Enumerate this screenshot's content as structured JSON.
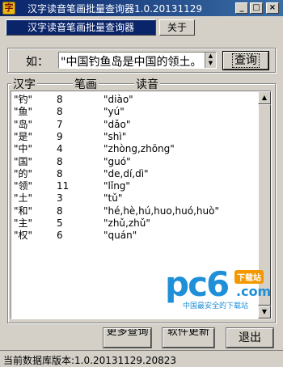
{
  "window": {
    "title": "汉字读音笔画批量查询器1.0.20131129",
    "minimize": "_",
    "maximize": "□",
    "close": "×"
  },
  "tabs": {
    "main": "汉字读音笔画批量查询器",
    "about": "关于"
  },
  "query": {
    "example_label": "如：",
    "input_value": "\"中国钓鱼岛是中国的领土。",
    "button": "查询"
  },
  "results": {
    "columns": {
      "char": "汉字",
      "stroke": "笔画",
      "pron": "读音"
    },
    "rows": [
      {
        "char": "\"钓\"",
        "stroke": "8",
        "pron": "\"diào\""
      },
      {
        "char": "\"鱼\"",
        "stroke": "8",
        "pron": "\"yú\""
      },
      {
        "char": "\"岛\"",
        "stroke": "7",
        "pron": "\"dǎo\""
      },
      {
        "char": "\"是\"",
        "stroke": "9",
        "pron": "\"shì\""
      },
      {
        "char": "\"中\"",
        "stroke": "4",
        "pron": "\"zhòng,zhōng\""
      },
      {
        "char": "\"国\"",
        "stroke": "8",
        "pron": "\"guó\""
      },
      {
        "char": "\"的\"",
        "stroke": "8",
        "pron": "\"de,dí,dì\""
      },
      {
        "char": "\"领\"",
        "stroke": "11",
        "pron": "\"lǐng\""
      },
      {
        "char": "\"土\"",
        "stroke": "3",
        "pron": "\"tǔ\""
      },
      {
        "char": "\"和\"",
        "stroke": "8",
        "pron": "\"hé,hè,hú,huo,huó,huò\""
      },
      {
        "char": "\"主\"",
        "stroke": "5",
        "pron": "\"zhǔ,zhǔ\""
      },
      {
        "char": "\"权\"",
        "stroke": "6",
        "pron": "\"quán\""
      }
    ]
  },
  "watermark": {
    "brand": "pc6",
    "badge": "下载站",
    "domain": ".com",
    "slogan": "中国最安全的下载站"
  },
  "buttons": {
    "more_query": "更多查询",
    "software_update": "软件更新",
    "exit": "退出"
  },
  "status": {
    "db_version": "当前数据库版本:1.0.20131129.20823"
  }
}
